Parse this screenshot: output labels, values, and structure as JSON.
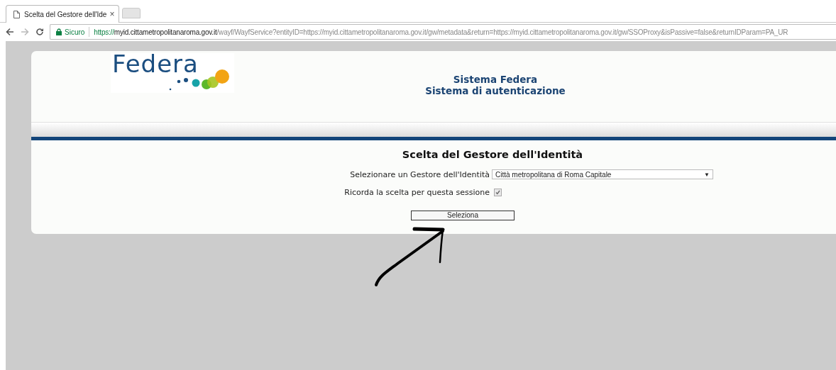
{
  "browser": {
    "tabs": [
      {
        "title": "Scelta del Gestore dell'Ide",
        "close": "×",
        "selected": true
      },
      {
        "selected": false
      }
    ],
    "address": {
      "security": "Sicuro",
      "scheme": "https://",
      "host": "myid.cittametropolitanaroma.gov.it",
      "path": "/wayf/WayfService?entityID=https://myid.cittametropolitanaroma.gov.it/gw/metadata&return=https://myid.cittametropolitanaroma.gov.it/gw/SSOProxy&isPassive=false&returnIDParam=PA_UR"
    }
  },
  "header": {
    "logo": "Federa",
    "title": "Sistema Federa",
    "subtitle": "Sistema di autenticazione"
  },
  "form": {
    "heading": "Scelta del Gestore dell'Identità",
    "select_label": "Selezionare un Gestore dell'Identità",
    "select_value": "Città metropolitana di Roma Capitale",
    "select_caret": "▼",
    "remember_label": "Ricorda la scelta per questa sessione",
    "remember_checked": true,
    "button": "Seleziona"
  }
}
